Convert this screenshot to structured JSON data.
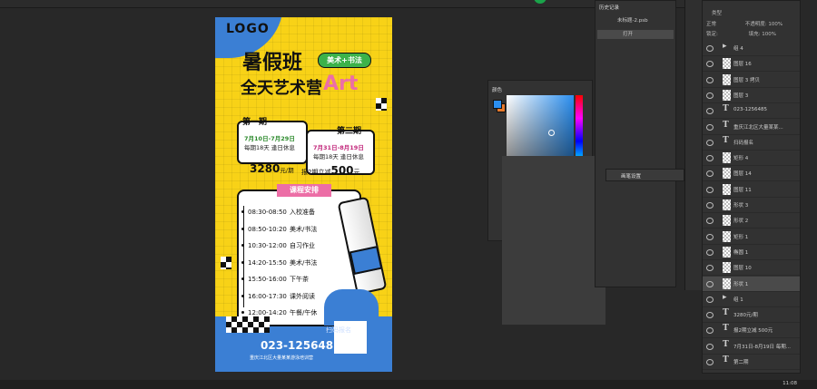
{
  "poster": {
    "logo": "LOGO",
    "title_line1": "暑假班",
    "tag": "美术+书法",
    "title_line2": "全天艺术营",
    "art": "Art",
    "period1": {
      "title": "第一期",
      "dates": "7月10日-7月29日",
      "note": "每期18天 逢日休息"
    },
    "period2": {
      "title": "第二期",
      "dates": "7月31日-8月19日",
      "note": "每期18天 逢日休息"
    },
    "price": "3280",
    "price_unit": "元/期",
    "promo_label": "报2期立减",
    "promo_value": "500",
    "promo_unit": "元",
    "schedule_title": "课程安排",
    "schedule": [
      {
        "time": "08:30-08:50",
        "item": "入校准备"
      },
      {
        "time": "08:50-10:20",
        "item": "美术/书法"
      },
      {
        "time": "10:30-12:00",
        "item": "自习作业"
      },
      {
        "time": "14:20-15:50",
        "item": "美术/书法"
      },
      {
        "time": "15:50-16:00",
        "item": "下午茶"
      },
      {
        "time": "16:00-17:30",
        "item": "课外阅读"
      },
      {
        "time": "12:00-14:20",
        "item": "午餐/午休"
      }
    ],
    "scan_label": "扫码报名",
    "phone": "023-1256485",
    "address": "重庆江北区大量某某游泳培训营"
  },
  "color_panel": {
    "title": "颜色",
    "fg": "#2b8ff0",
    "bg": "#e87a2c"
  },
  "history_panel": {
    "title": "历史记录",
    "file": "未标题-2.psb",
    "item": "打开"
  },
  "brush_panel": {
    "title": "画笔设置"
  },
  "layers_panel": {
    "kind": "类型",
    "blend": "正常",
    "opacity_label": "不透明度:",
    "opacity": "100%",
    "lock_label": "锁定:",
    "fill_label": "填充:",
    "fill": "100%",
    "layers": [
      {
        "name": "组 4",
        "type": "group"
      },
      {
        "name": "图层 16",
        "type": "raster"
      },
      {
        "name": "图层 3 拷贝",
        "type": "raster"
      },
      {
        "name": "图层 3",
        "type": "raster"
      },
      {
        "name": "023-1256485",
        "type": "text"
      },
      {
        "name": "重庆江北区大量某某...",
        "type": "text"
      },
      {
        "name": "扫码报名",
        "type": "text"
      },
      {
        "name": "矩形 4",
        "type": "raster"
      },
      {
        "name": "图层 14",
        "type": "raster"
      },
      {
        "name": "图层 11",
        "type": "raster"
      },
      {
        "name": "形状 3",
        "type": "raster"
      },
      {
        "name": "形状 2",
        "type": "raster"
      },
      {
        "name": "矩形 1",
        "type": "raster"
      },
      {
        "name": "椭圆 1",
        "type": "raster"
      },
      {
        "name": "图层 10",
        "type": "raster"
      },
      {
        "name": "形状 1",
        "type": "raster"
      },
      {
        "name": "组 1",
        "type": "group"
      },
      {
        "name": "3280元/期",
        "type": "text"
      },
      {
        "name": "报2期立减 500元",
        "type": "text"
      },
      {
        "name": "7月31日-8月19日 每期...",
        "type": "text"
      },
      {
        "name": "第二期",
        "type": "text"
      }
    ]
  },
  "clock": "11:08"
}
